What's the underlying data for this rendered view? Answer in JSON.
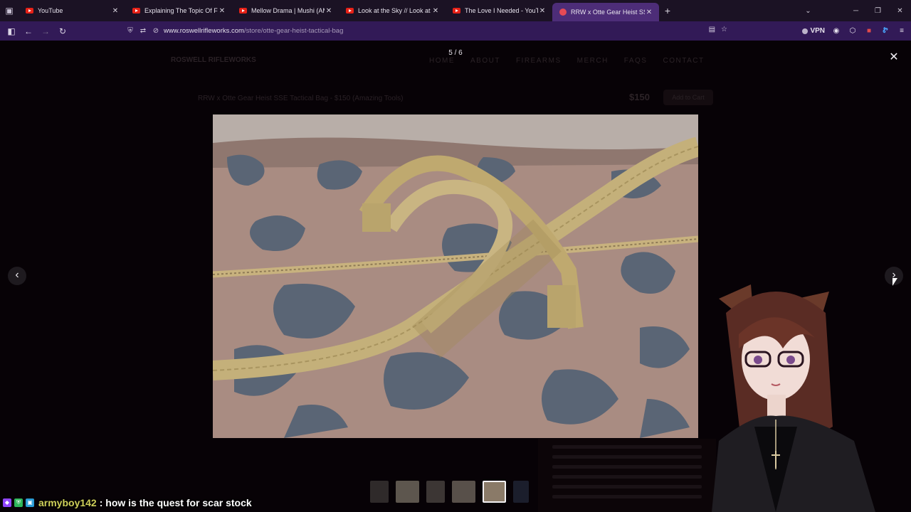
{
  "browser": {
    "tabs": [
      {
        "label": "YouTube",
        "icon": "youtube-icon",
        "active": false
      },
      {
        "label": "Explaining The Topic Of FEMALE",
        "icon": "youtube-icon",
        "active": false
      },
      {
        "label": "Mellow Drama | Mushi (AMV) (S",
        "icon": "youtube-icon",
        "active": false
      },
      {
        "label": "Look at the Sky // Look at the S",
        "icon": "youtube-icon",
        "active": false
      },
      {
        "label": "The Love I Needed - YouTube",
        "icon": "youtube-icon",
        "active": false
      },
      {
        "label": "RRW x Otte Gear Heist SSE Tact",
        "icon": "site-favicon-icon",
        "active": true
      }
    ],
    "new_tab": "+",
    "url_host": "www.roswellrifleworks.com",
    "url_path": "/store/otte-gear-heist-tactical-bag",
    "vpn_label": "VPN",
    "accent": "#4d2d78"
  },
  "site": {
    "logo": "ROSWELL RIFLEWORKS",
    "nav": [
      "HOME",
      "ABOUT",
      "FIREARMS",
      "MERCH",
      "FAQS",
      "CONTACT"
    ],
    "product_title": "RRW x Otte Gear Heist SSE Tactical Bag - $150 (Amazing Tools)",
    "price": "$150",
    "add_to_cart": "Add to Cart"
  },
  "lightbox": {
    "counter": "5 / 6",
    "close": "✕",
    "prev": "‹",
    "next": "›",
    "image_alt": "Camo tactical bag with tan webbing straps",
    "thumbnail_count": 6,
    "active_thumbnail_index": 4
  },
  "chat": {
    "username": "armyboy142",
    "message": ": how is the quest for scar stock"
  }
}
